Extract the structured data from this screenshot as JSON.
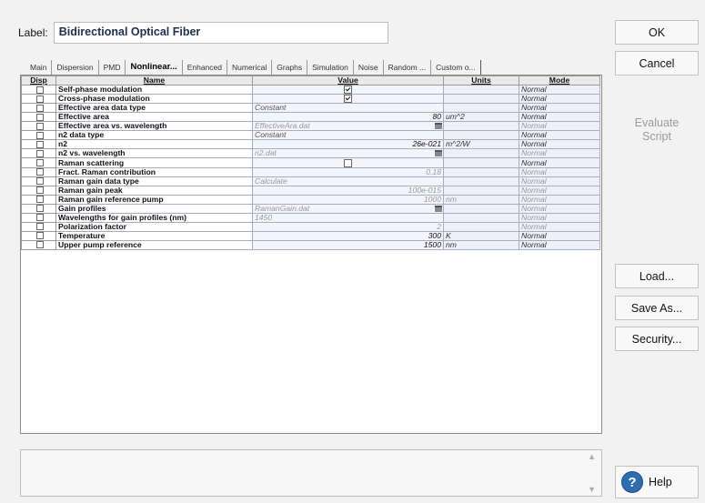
{
  "label": {
    "caption": "Label:",
    "value": "Bidirectional Optical Fiber"
  },
  "tabs": [
    {
      "label": "Main",
      "active": false
    },
    {
      "label": "Dispersion",
      "active": false
    },
    {
      "label": "PMD",
      "active": false
    },
    {
      "label": "Nonlinear...",
      "active": true
    },
    {
      "label": "Enhanced",
      "active": false
    },
    {
      "label": "Numerical",
      "active": false
    },
    {
      "label": "Graphs",
      "active": false
    },
    {
      "label": "Simulation",
      "active": false
    },
    {
      "label": "Noise",
      "active": false
    },
    {
      "label": "Random ...",
      "active": false
    },
    {
      "label": "Custom o...",
      "active": false
    }
  ],
  "table": {
    "headers": {
      "disp": "Disp",
      "name": "Name",
      "value": "Value",
      "units": "Units",
      "mode": "Mode"
    },
    "rows": [
      {
        "name": "Self-phase modulation",
        "value": "",
        "value_type": "checkbox_checked",
        "units": "",
        "mode": "Normal"
      },
      {
        "name": "Cross-phase modulation",
        "value": "",
        "value_type": "checkbox_checked",
        "units": "",
        "mode": "Normal"
      },
      {
        "name": "Effective area data type",
        "value": "Constant",
        "value_type": "text_left",
        "units": "",
        "mode": "Normal"
      },
      {
        "name": "Effective area",
        "value": "80",
        "value_type": "number",
        "units": "um^2",
        "mode": "Normal"
      },
      {
        "name": "Effective area vs. wavelength",
        "value": "EffectiveAra.dat",
        "value_type": "file_grey",
        "units": "",
        "mode": "Normal",
        "mode_grey": true
      },
      {
        "name": "n2 data type",
        "value": "Constant",
        "value_type": "text_left",
        "units": "",
        "mode": "Normal"
      },
      {
        "name": "n2",
        "value": "26e-021",
        "value_type": "number",
        "units": "m^2/W",
        "mode": "Normal"
      },
      {
        "name": "n2 vs. wavelength",
        "value": "n2.dat",
        "value_type": "file_grey",
        "units": "",
        "mode": "Normal",
        "mode_grey": true
      },
      {
        "name": "Raman scattering",
        "value": "",
        "value_type": "checkbox_empty",
        "units": "",
        "mode": "Normal"
      },
      {
        "name": "Fract. Raman contribution",
        "value": "0.18",
        "value_type": "number_grey",
        "units": "",
        "mode": "Normal",
        "mode_grey": true
      },
      {
        "name": "Raman gain data type",
        "value": "Calculate",
        "value_type": "text_left_grey",
        "units": "",
        "mode": "Normal",
        "mode_grey": true
      },
      {
        "name": "Raman gain peak",
        "value": "100e-015",
        "value_type": "number_grey",
        "units": "",
        "mode": "Normal",
        "mode_grey": true
      },
      {
        "name": "Raman gain reference pump",
        "value": "1000",
        "value_type": "number_grey",
        "units": "nm",
        "units_grey": true,
        "mode": "Normal",
        "mode_grey": true
      },
      {
        "name": "Gain profiles",
        "value": "RamanGain.dat",
        "value_type": "file_grey",
        "units": "",
        "mode": "Normal",
        "mode_grey": true
      },
      {
        "name": "Wavelengths for gain profiles (nm)",
        "value": "1450",
        "value_type": "text_left_grey",
        "units": "",
        "mode": "Normal",
        "mode_grey": true
      },
      {
        "name": "Polarization factor",
        "value": "2",
        "value_type": "number_grey",
        "units": "",
        "mode": "Normal",
        "mode_grey": true
      },
      {
        "name": "Temperature",
        "value": "300",
        "value_type": "number",
        "units": "K",
        "mode": "Normal"
      },
      {
        "name": "Upper pump reference",
        "value": "1500",
        "value_type": "number",
        "units": "nm",
        "mode": "Normal"
      }
    ]
  },
  "buttons": {
    "ok": "OK",
    "cancel": "Cancel",
    "evaluate_line1": "Evaluate",
    "evaluate_line2": "Script",
    "load": "Load...",
    "save_as": "Save As...",
    "security": "Security...",
    "help": "Help"
  },
  "icons": {
    "help": "?"
  },
  "colors": {
    "help_icon": "#2f6db3",
    "label_text": "#1f2d4f"
  }
}
